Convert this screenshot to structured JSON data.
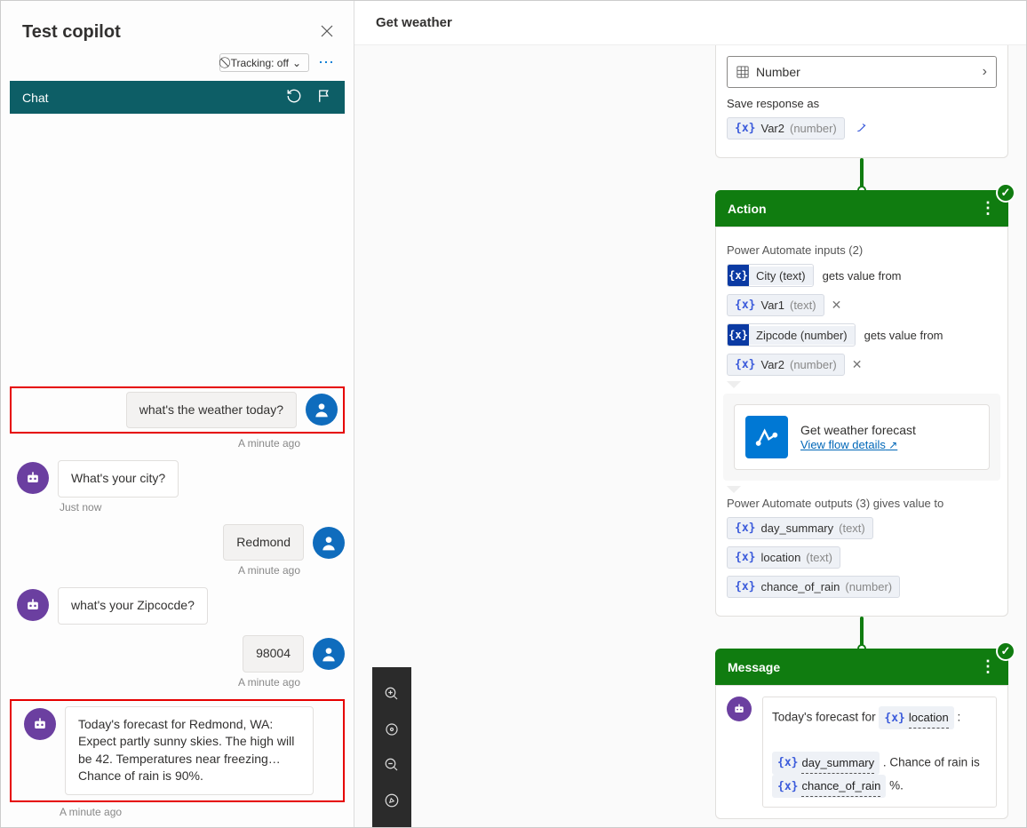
{
  "leftPanel": {
    "title": "Test copilot",
    "tracking": "Tracking: off",
    "chatLabel": "Chat",
    "messages": [
      {
        "role": "user",
        "text": "what's the weather today?",
        "ts": "A minute ago",
        "highlight": true
      },
      {
        "role": "bot",
        "text": "What's your city?",
        "ts": "Just now"
      },
      {
        "role": "user",
        "text": "Redmond",
        "ts": "A minute ago"
      },
      {
        "role": "bot",
        "text": "what's your Zipcocde?",
        "ts": ""
      },
      {
        "role": "user",
        "text": "98004",
        "ts": "A minute ago"
      },
      {
        "role": "bot",
        "text": "Today's forecast for Redmond, WA: Expect partly sunny skies. The high will be 42. Temperatures near freezing… Chance of rain is 90%.",
        "ts": "A minute ago",
        "highlight": true
      }
    ]
  },
  "canvas": {
    "title": "Get weather",
    "topCard": {
      "selectValue": "Number",
      "saveLabel": "Save response as",
      "saveVar": "Var2",
      "saveVarType": "(number)"
    },
    "actionCard": {
      "header": "Action",
      "inputsLabel": "Power Automate inputs (2)",
      "inputs": [
        {
          "param": "City",
          "ptype": "(text)",
          "mid": "gets value from",
          "var": "Var1",
          "vtype": "(text)"
        },
        {
          "param": "Zipcode",
          "ptype": "(number)",
          "mid": "gets value from",
          "var": "Var2",
          "vtype": "(number)"
        }
      ],
      "flowTitle": "Get weather forecast",
      "flowLink": "View flow details",
      "outputsLabel": "Power Automate outputs (3) gives value to",
      "outputs": [
        {
          "name": "day_summary",
          "otype": "(text)"
        },
        {
          "name": "location",
          "otype": "(text)"
        },
        {
          "name": "chance_of_rain",
          "otype": "(number)"
        }
      ]
    },
    "messageCard": {
      "header": "Message",
      "line1_pre": "Today's forecast for ",
      "line1_token": "location",
      "line1_post": " :",
      "line2_token1": "day_summary",
      "line2_mid": " . Chance of rain is ",
      "line2_token2": "chance_of_rain",
      "line2_post": " %."
    },
    "tokenGlyph": "{x}"
  }
}
